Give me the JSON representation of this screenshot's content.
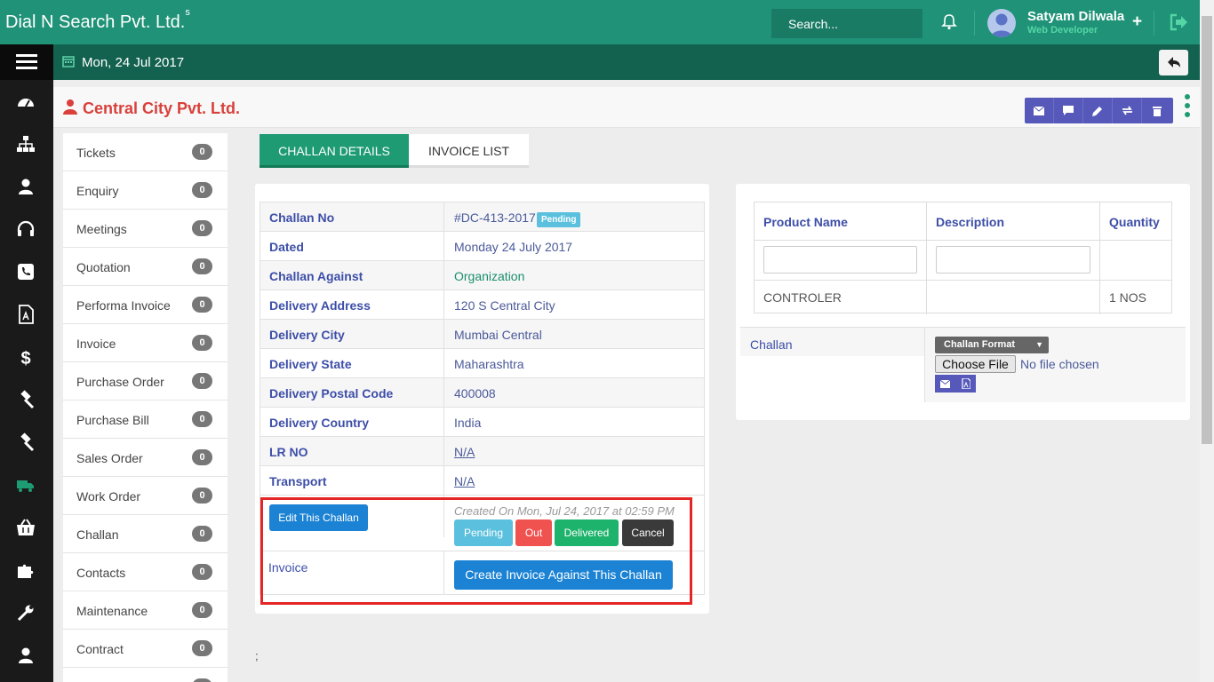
{
  "header": {
    "brand": "Dial N Search Pvt. Ltd.",
    "brand_sup": "s",
    "search_placeholder": "Search...",
    "user_name": "Satyam Dilwala",
    "user_role": "Web Developer",
    "plus_label": "+"
  },
  "subbar": {
    "date": "Mon, 24 Jul 2017"
  },
  "page": {
    "company": "Central City Pvt. Ltd."
  },
  "side_list": [
    {
      "label": "Tickets",
      "count": "0"
    },
    {
      "label": "Enquiry",
      "count": "0"
    },
    {
      "label": "Meetings",
      "count": "0"
    },
    {
      "label": "Quotation",
      "count": "0"
    },
    {
      "label": "Performa Invoice",
      "count": "0"
    },
    {
      "label": "Invoice",
      "count": "0"
    },
    {
      "label": "Purchase Order",
      "count": "0"
    },
    {
      "label": "Purchase Bill",
      "count": "0"
    },
    {
      "label": "Sales Order",
      "count": "0"
    },
    {
      "label": "Work Order",
      "count": "0"
    },
    {
      "label": "Challan",
      "count": "0"
    },
    {
      "label": "Contacts",
      "count": "0"
    },
    {
      "label": "Maintenance",
      "count": "0"
    },
    {
      "label": "Contract",
      "count": "0"
    }
  ],
  "tabs": {
    "active": "CHALLAN DETAILS",
    "inactive": "INVOICE LIST"
  },
  "details": [
    {
      "key": "Challan No",
      "value": "#DC-413-2017"
    },
    {
      "key": "Dated",
      "value": "Monday 24 July 2017"
    },
    {
      "key": "Challan Against",
      "value": "Organization"
    },
    {
      "key": "Delivery Address",
      "value": "120 S Central City"
    },
    {
      "key": "Delivery City",
      "value": "Mumbai Central"
    },
    {
      "key": "Delivery State",
      "value": "Maharashtra"
    },
    {
      "key": "Delivery Postal Code",
      "value": "400008"
    },
    {
      "key": "Delivery Country",
      "value": "India"
    },
    {
      "key": "LR NO",
      "value": "N/A"
    },
    {
      "key": "Transport",
      "value": "N/A"
    }
  ],
  "status_badge": "Pending",
  "actions": {
    "edit": "Edit This Challan",
    "created_on": "Created On Mon, Jul 24, 2017 at 02:59 PM",
    "pending": "Pending",
    "out": "Out",
    "delivered": "Delivered",
    "cancel": "Cancel",
    "invoice_label": "Invoice",
    "create_invoice": "Create Invoice Against This Challan"
  },
  "products": {
    "headers": [
      "Product Name",
      "Description",
      "Quantity"
    ],
    "row": {
      "name": "CONTROLER",
      "description": "",
      "quantity": "1 NOS"
    }
  },
  "challan_section": {
    "label": "Challan",
    "format": "Challan Format",
    "file_button": "Choose File",
    "file_status": "No file chosen"
  },
  "footer_text": ";",
  "colors": {
    "header_green": "#1f9277",
    "subbar_green": "#136250",
    "company_red": "#d9403b",
    "primary_blue": "#1b82d4",
    "action_purple": "#5659b9"
  }
}
